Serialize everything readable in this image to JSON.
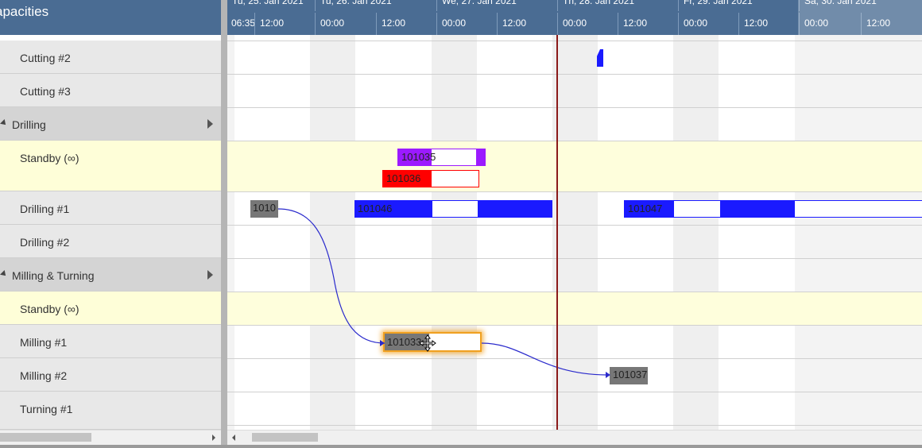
{
  "left_panel": {
    "title": "apacities",
    "rows": [
      {
        "label": "Cutting #2"
      },
      {
        "label": "Cutting #3"
      },
      {
        "label": "Drilling"
      },
      {
        "label": "Standby (∞)"
      },
      {
        "label": "Drilling #1"
      },
      {
        "label": "Drilling #2"
      },
      {
        "label": "Milling & Turning"
      },
      {
        "label": "Standby (∞)"
      },
      {
        "label": "Milling #1"
      },
      {
        "label": "Milling #2"
      },
      {
        "label": "Turning #1"
      }
    ]
  },
  "timeline": {
    "days": [
      {
        "label": "Tu, 25. Jan 2021"
      },
      {
        "label": "Tu, 26. Jan 2021"
      },
      {
        "label": "We, 27. Jan 2021"
      },
      {
        "label": "Th, 28. Jan 2021"
      },
      {
        "label": "Fr, 29. Jan 2021"
      },
      {
        "label": "Sa, 30. Jan 2021"
      }
    ],
    "hours": [
      {
        "label": "06:35"
      },
      {
        "label": "12:00"
      },
      {
        "label": "00:00"
      },
      {
        "label": "12:00"
      },
      {
        "label": "00:00"
      },
      {
        "label": "12:00"
      },
      {
        "label": "00:00"
      },
      {
        "label": "12:00"
      },
      {
        "label": "00:00"
      },
      {
        "label": "12:00"
      },
      {
        "label": "00:00"
      },
      {
        "label": "12:00"
      }
    ]
  },
  "tasks": [
    {
      "id": "small",
      "label": "",
      "color": "#1a1aff"
    },
    {
      "id": "t101035",
      "label": "101035",
      "color": "#9b1aff"
    },
    {
      "id": "t101036",
      "label": "101036",
      "color": "#ff0000"
    },
    {
      "id": "t10104x",
      "label": "1010",
      "color": "#777777"
    },
    {
      "id": "t101046",
      "label": "101046",
      "color": "#1a1aff"
    },
    {
      "id": "t101047",
      "label": "101047",
      "color": "#1a1aff"
    },
    {
      "id": "t101033",
      "label": "101033",
      "color": "#777777"
    },
    {
      "id": "t101037",
      "label": "101037",
      "color": "#777777"
    }
  ],
  "colors": {
    "header_bg": "#4a6c93",
    "now_line": "#8b1a1a",
    "selection_glow": "#f0a020",
    "link_line": "#2a2acc"
  }
}
